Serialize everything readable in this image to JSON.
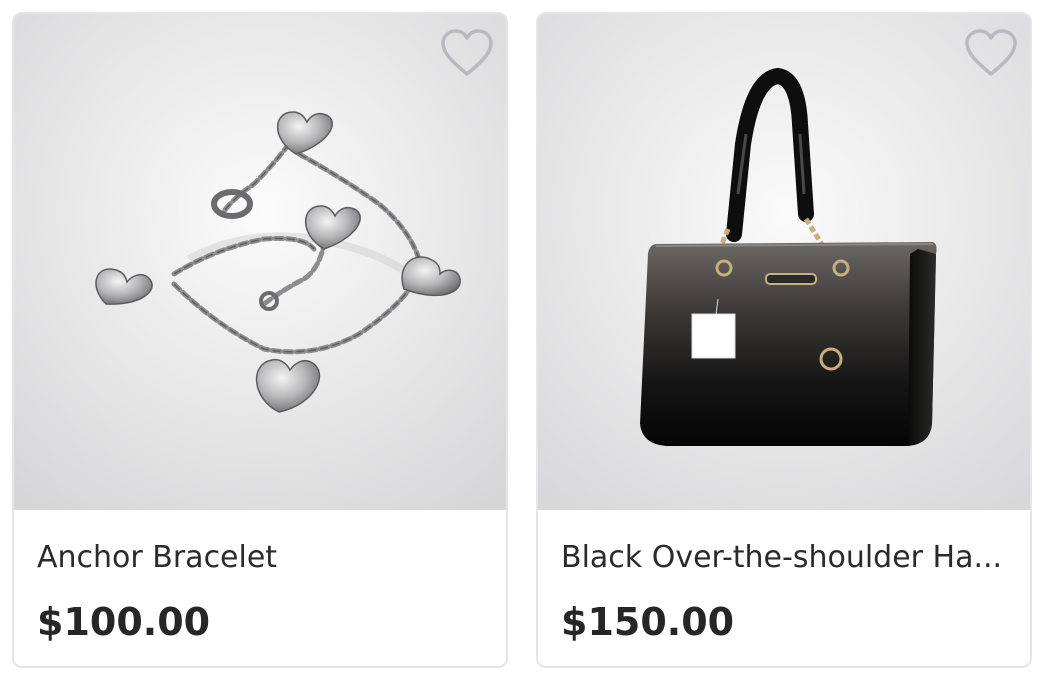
{
  "products": [
    {
      "title": "Anchor Bracelet",
      "price": "$100.00",
      "image": "silver-heart-charm-bracelet",
      "favorite_icon": "heart-outline-icon"
    },
    {
      "title": "Black Over-the-shoulder Ha...",
      "price": "$150.00",
      "image": "black-patent-handbag",
      "favorite_icon": "heart-outline-icon"
    }
  ],
  "colors": {
    "card_border": "#e6e6e8",
    "icon_stroke": "#b9b9bf",
    "title_text": "#2b2b2b",
    "price_text": "#262626"
  }
}
